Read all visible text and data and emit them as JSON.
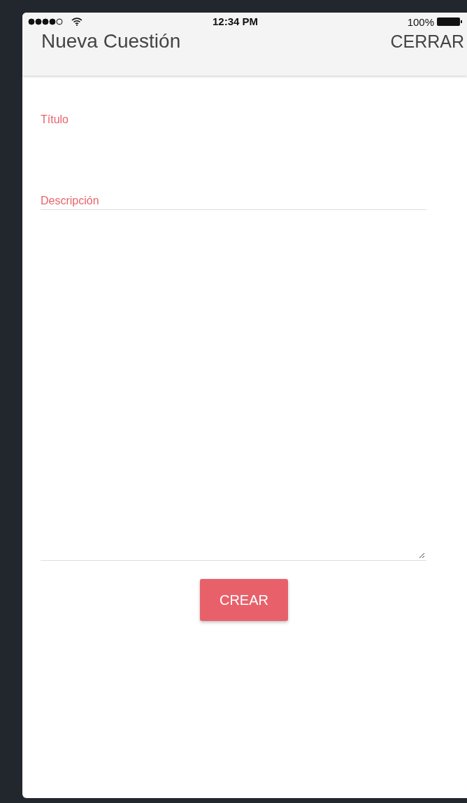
{
  "status_bar": {
    "time": "12:34 PM",
    "battery": "100%"
  },
  "header": {
    "title": "Nueva Cuestión",
    "close": "CERRAR"
  },
  "form": {
    "fields": [
      {
        "kind": "input",
        "label": "Título"
      },
      {
        "kind": "textarea",
        "label": "Descripción"
      }
    ],
    "submit": "CREAR"
  }
}
